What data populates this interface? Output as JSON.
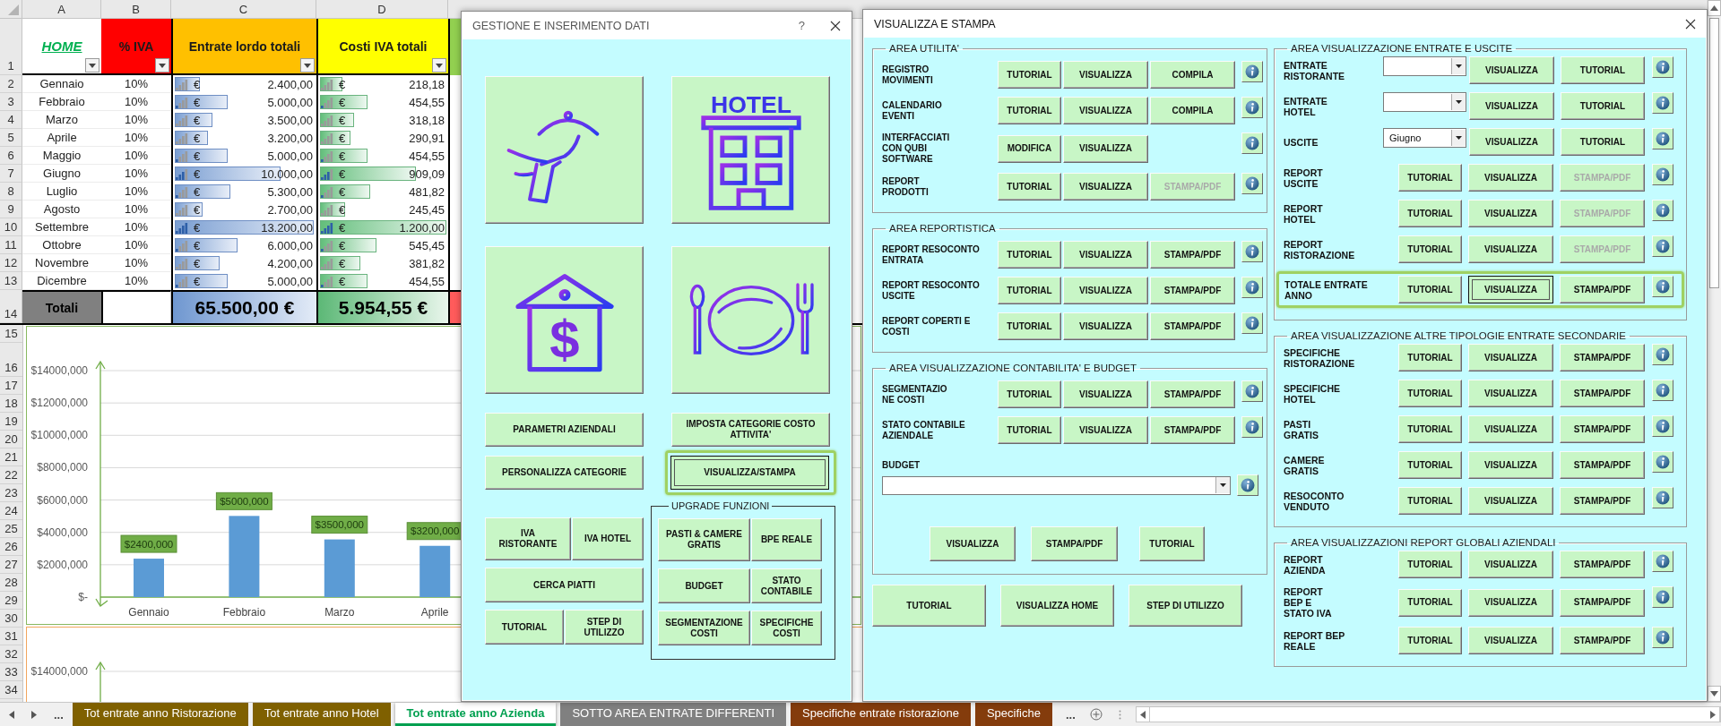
{
  "sheet": {
    "column_letters": [
      "A",
      "B",
      "C",
      "D"
    ],
    "columns": [
      {
        "label": "HOME",
        "kind": "link",
        "color": "#ffffff"
      },
      {
        "label": "% IVA",
        "kind": "text",
        "color": "#ff0000"
      },
      {
        "label": "Entrate lordo totali",
        "kind": "text",
        "color": "#ffc000"
      },
      {
        "label": "Costi IVA totali",
        "kind": "text",
        "color": "#ffff00"
      }
    ],
    "row_numbers": [
      "1",
      "2",
      "3",
      "4",
      "5",
      "6",
      "7",
      "8",
      "9",
      "10",
      "11",
      "12",
      "13",
      "14",
      "15",
      "16",
      "17",
      "18",
      "19",
      "20",
      "21",
      "22",
      "23",
      "24",
      "25",
      "26",
      "27",
      "28",
      "29",
      "30",
      "31",
      "32",
      "33",
      "34"
    ],
    "rows": [
      {
        "month": "Gennaio",
        "vat": "10%",
        "income": {
          "currency": "€",
          "value": "2.400,00",
          "level": 0.18
        },
        "vat_costs": {
          "currency": "€",
          "value": "218,18",
          "level": 0.18
        }
      },
      {
        "month": "Febbraio",
        "vat": "10%",
        "income": {
          "currency": "€",
          "value": "5.000,00",
          "level": 0.38
        },
        "vat_costs": {
          "currency": "€",
          "value": "454,55",
          "level": 0.38
        }
      },
      {
        "month": "Marzo",
        "vat": "10%",
        "income": {
          "currency": "€",
          "value": "3.500,00",
          "level": 0.27
        },
        "vat_costs": {
          "currency": "€",
          "value": "318,18",
          "level": 0.27
        }
      },
      {
        "month": "Aprile",
        "vat": "10%",
        "income": {
          "currency": "€",
          "value": "3.200,00",
          "level": 0.24
        },
        "vat_costs": {
          "currency": "€",
          "value": "290,91",
          "level": 0.24
        }
      },
      {
        "month": "Maggio",
        "vat": "10%",
        "income": {
          "currency": "€",
          "value": "5.000,00",
          "level": 0.38
        },
        "vat_costs": {
          "currency": "€",
          "value": "454,55",
          "level": 0.38
        }
      },
      {
        "month": "Giugno",
        "vat": "10%",
        "income": {
          "currency": "€",
          "value": "10.000,00",
          "level": 0.76
        },
        "vat_costs": {
          "currency": "€",
          "value": "909,09",
          "level": 0.76
        }
      },
      {
        "month": "Luglio",
        "vat": "10%",
        "income": {
          "currency": "€",
          "value": "5.300,00",
          "level": 0.4
        },
        "vat_costs": {
          "currency": "€",
          "value": "481,82",
          "level": 0.4
        }
      },
      {
        "month": "Agosto",
        "vat": "10%",
        "income": {
          "currency": "€",
          "value": "2.700,00",
          "level": 0.2
        },
        "vat_costs": {
          "currency": "€",
          "value": "245,45",
          "level": 0.2
        }
      },
      {
        "month": "Settembre",
        "vat": "10%",
        "income": {
          "currency": "€",
          "value": "13.200,00",
          "level": 1
        },
        "vat_costs": {
          "currency": "€",
          "value": "1.200,00",
          "level": 1
        }
      },
      {
        "month": "Ottobre",
        "vat": "10%",
        "income": {
          "currency": "€",
          "value": "6.000,00",
          "level": 0.45
        },
        "vat_costs": {
          "currency": "€",
          "value": "545,45",
          "level": 0.45
        }
      },
      {
        "month": "Novembre",
        "vat": "10%",
        "income": {
          "currency": "€",
          "value": "4.200,00",
          "level": 0.32
        },
        "vat_costs": {
          "currency": "€",
          "value": "381,82",
          "level": 0.32
        }
      },
      {
        "month": "Dicembre",
        "vat": "10%",
        "income": {
          "currency": "€",
          "value": "5.000,00",
          "level": 0.38
        },
        "vat_costs": {
          "currency": "€",
          "value": "454,55",
          "level": 0.38
        }
      }
    ],
    "totals": {
      "label": "Totali",
      "income": "65.500,00 €",
      "vat_costs": "5.954,55 €"
    },
    "chart": {
      "y_axis_labels": [
        "$14000,000",
        "$12000,000",
        "$10000,000",
        "$8000,000",
        "$6000,000",
        "$4000,000",
        "$2000,000",
        "$-"
      ],
      "value_labels": [
        "$2400,000",
        "$5000,000",
        "$3500,000",
        "$3200,000"
      ],
      "categories": [
        "Gennaio",
        "Febbraio",
        "Marzo",
        "Aprile"
      ]
    },
    "second_chart": {
      "ytick_label": "$14000,000"
    }
  },
  "sheet_tabs": {
    "more_left": "...",
    "tabs": [
      {
        "label": "Tot entrate anno Ristorazione",
        "color": "#7f6000",
        "selected": false
      },
      {
        "label": "Tot entrate anno Hotel",
        "color": "#7f6000",
        "selected": false
      },
      {
        "label": "Tot entrate anno Azienda",
        "color": "#00a050",
        "selected": true
      },
      {
        "label": "SOTTO AREA ENTRATE DIFFERENTI",
        "color": "#808080",
        "selected": false
      },
      {
        "label": "Specifiche entrate ristorazione",
        "color": "#843c0c",
        "selected": false
      },
      {
        "label": "Specifiche",
        "color": "#843c0c",
        "selected": false
      }
    ],
    "more_right": "..."
  },
  "management_dialog": {
    "title": "GESTIONE E INSERIMENTO DATI",
    "help": "?",
    "tiles": [
      {
        "kind": "waiter"
      },
      {
        "kind": "hotel",
        "sign": "HOTEL"
      },
      {
        "kind": "house-dollar",
        "sign": "$"
      },
      {
        "kind": "plate"
      }
    ],
    "buttons": [
      {
        "label": "PARAMETRI AZIENDALI",
        "focused": false,
        "highlighted": false
      },
      {
        "label": "IMPOSTA CATEGORIE COSTO\nATTIVITA'",
        "focused": false,
        "highlighted": false
      },
      {
        "label": "PERSONALIZZA CATEGORIE",
        "focused": false,
        "highlighted": false
      },
      {
        "label": "VISUALIZZA/STAMPA",
        "focused": true,
        "highlighted": true
      }
    ],
    "left_rows": [
      [
        {
          "label": "IVA\nRISTORANTE"
        },
        {
          "label": "IVA HOTEL"
        }
      ],
      [
        {
          "label": "CERCA PIATTI"
        }
      ],
      [
        {
          "label": "TUTORIAL"
        },
        {
          "label": "STEP DI\nUTILIZZO"
        }
      ]
    ],
    "upgrade": {
      "title": "UPGRADE FUNZIONI",
      "rows": [
        [
          {
            "label": "PASTI & CAMERE\nGRATIS"
          },
          {
            "label": "BPE REALE"
          }
        ],
        [
          {
            "label": "BUDGET"
          },
          {
            "label": "STATO\nCONTABILE"
          }
        ],
        [
          {
            "label": "SEGMENTAZIONE\nCOSTI"
          },
          {
            "label": "SPECIFICHE\nCOSTI"
          }
        ]
      ]
    }
  },
  "print_dialog": {
    "title": "VISUALIZZA E STAMPA",
    "columns": [
      {
        "groups": [
          {
            "title": "AREA UTILITA'",
            "rows": [
              {
                "kind": "row",
                "label": "REGISTRO\nMOVIMENTI",
                "highlighted": false,
                "info": true,
                "controls": [
                  {
                    "kind": "button",
                    "label": "TUTORIAL",
                    "disabled": false,
                    "focused": false
                  },
                  {
                    "kind": "button",
                    "label": "VISUALIZZA",
                    "disabled": false,
                    "focused": false
                  },
                  {
                    "kind": "button",
                    "label": "COMPILA",
                    "disabled": false,
                    "focused": false
                  }
                ]
              },
              {
                "kind": "row",
                "label": "CALENDARIO\nEVENTI",
                "highlighted": false,
                "info": true,
                "controls": [
                  {
                    "kind": "button",
                    "label": "TUTORIAL",
                    "disabled": false,
                    "focused": false
                  },
                  {
                    "kind": "button",
                    "label": "VISUALIZZA",
                    "disabled": false,
                    "focused": false
                  },
                  {
                    "kind": "button",
                    "label": "COMPILA",
                    "disabled": false,
                    "focused": false
                  }
                ]
              },
              {
                "kind": "row",
                "label": "INTERFACCIATI\nCON QUBI\nSOFTWARE",
                "highlighted": false,
                "info": true,
                "controls": [
                  {
                    "kind": "button",
                    "label": "MODIFICA",
                    "disabled": false,
                    "focused": false
                  },
                  {
                    "kind": "button",
                    "label": "VISUALIZZA",
                    "disabled": false,
                    "focused": false
                  }
                ]
              },
              {
                "kind": "row",
                "label": "REPORT\nPRODOTTI",
                "highlighted": false,
                "info": true,
                "controls": [
                  {
                    "kind": "button",
                    "label": "TUTORIAL",
                    "disabled": false,
                    "focused": false
                  },
                  {
                    "kind": "button",
                    "label": "VISUALIZZA",
                    "disabled": false,
                    "focused": false
                  },
                  {
                    "kind": "button",
                    "label": "STAMPA/PDF",
                    "disabled": true,
                    "focused": false
                  }
                ]
              }
            ]
          },
          {
            "title": "AREA REPORTISTICA",
            "rows": [
              {
                "kind": "row",
                "label": "REPORT RESOCONTO\nENTRATA",
                "highlighted": false,
                "info": true,
                "controls": [
                  {
                    "kind": "button",
                    "label": "TUTORIAL",
                    "disabled": false,
                    "focused": false
                  },
                  {
                    "kind": "button",
                    "label": "VISUALIZZA",
                    "disabled": false,
                    "focused": false
                  },
                  {
                    "kind": "button",
                    "label": "STAMPA/PDF",
                    "disabled": false,
                    "focused": false
                  }
                ]
              },
              {
                "kind": "row",
                "label": "REPORT RESOCONTO\nUSCITE",
                "highlighted": false,
                "info": true,
                "controls": [
                  {
                    "kind": "button",
                    "label": "TUTORIAL",
                    "disabled": false,
                    "focused": false
                  },
                  {
                    "kind": "button",
                    "label": "VISUALIZZA",
                    "disabled": false,
                    "focused": false
                  },
                  {
                    "kind": "button",
                    "label": "STAMPA/PDF",
                    "disabled": false,
                    "focused": false
                  }
                ]
              },
              {
                "kind": "row",
                "label": "REPORT COPERTI E\nCOSTI",
                "highlighted": false,
                "info": true,
                "controls": [
                  {
                    "kind": "button",
                    "label": "TUTORIAL",
                    "disabled": false,
                    "focused": false
                  },
                  {
                    "kind": "button",
                    "label": "VISUALIZZA",
                    "disabled": false,
                    "focused": false
                  },
                  {
                    "kind": "button",
                    "label": "STAMPA/PDF",
                    "disabled": false,
                    "focused": false
                  }
                ]
              }
            ]
          },
          {
            "title": "AREA VISUALIZZAZIONE CONTABILITA' E BUDGET",
            "rows": [
              {
                "kind": "row",
                "label": "SEGMENTAZIO\nNE COSTI",
                "highlighted": false,
                "info": true,
                "controls": [
                  {
                    "kind": "button",
                    "label": "TUTORIAL",
                    "disabled": false,
                    "focused": false
                  },
                  {
                    "kind": "button",
                    "label": "VISUALIZZA",
                    "disabled": false,
                    "focused": false
                  },
                  {
                    "kind": "button",
                    "label": "STAMPA/PDF",
                    "disabled": false,
                    "focused": false
                  }
                ]
              },
              {
                "kind": "row",
                "label": "STATO CONTABILE\nAZIENDALE",
                "highlighted": false,
                "info": true,
                "controls": [
                  {
                    "kind": "button",
                    "label": "TUTORIAL",
                    "disabled": false,
                    "focused": false
                  },
                  {
                    "kind": "button",
                    "label": "VISUALIZZA",
                    "disabled": false,
                    "focused": false
                  },
                  {
                    "kind": "button",
                    "label": "STAMPA/PDF",
                    "disabled": false,
                    "focused": false
                  }
                ]
              },
              {
                "kind": "caption",
                "label": "BUDGET"
              },
              {
                "kind": "wide-dropdown",
                "info": true
              },
              {
                "kind": "button-bar",
                "controls": [
                  {
                    "kind": "button",
                    "label": "VISUALIZZA",
                    "disabled": false,
                    "focused": false
                  },
                  {
                    "kind": "button",
                    "label": "STAMPA/PDF",
                    "disabled": false,
                    "focused": false
                  },
                  {
                    "kind": "button",
                    "label": "TUTORIAL",
                    "disabled": false,
                    "focused": false
                  }
                ]
              }
            ]
          }
        ],
        "footer": [
          {
            "label": "TUTORIAL"
          },
          {
            "label": "VISUALIZZA HOME"
          },
          {
            "label": "STEP DI UTILIZZO"
          }
        ]
      },
      {
        "groups": [
          {
            "title": "AREA VISUALIZZAZIONE ENTRATE E USCITE",
            "rows": [
              {
                "kind": "row",
                "label": "ENTRATE\nRISTORANTE",
                "highlighted": false,
                "info": true,
                "controls": [
                  {
                    "kind": "dropdown"
                  },
                  {
                    "kind": "button",
                    "label": "VISUALIZZA",
                    "disabled": false,
                    "focused": false
                  },
                  {
                    "kind": "button",
                    "label": "TUTORIAL",
                    "disabled": false,
                    "focused": false
                  }
                ]
              },
              {
                "kind": "row",
                "label": "ENTRATE\nHOTEL",
                "highlighted": false,
                "info": true,
                "controls": [
                  {
                    "kind": "dropdown"
                  },
                  {
                    "kind": "button",
                    "label": "VISUALIZZA",
                    "disabled": false,
                    "focused": false
                  },
                  {
                    "kind": "button",
                    "label": "TUTORIAL",
                    "disabled": false,
                    "focused": false
                  }
                ]
              },
              {
                "kind": "row",
                "label": "USCITE",
                "highlighted": false,
                "info": true,
                "controls": [
                  {
                    "kind": "dropdown",
                    "value": "Giugno"
                  },
                  {
                    "kind": "button",
                    "label": "VISUALIZZA",
                    "disabled": false,
                    "focused": false
                  },
                  {
                    "kind": "button",
                    "label": "TUTORIAL",
                    "disabled": false,
                    "focused": false
                  }
                ]
              },
              {
                "kind": "row",
                "label": "REPORT\nUSCITE",
                "highlighted": false,
                "info": true,
                "controls": [
                  {
                    "kind": "button",
                    "label": "TUTORIAL",
                    "disabled": false,
                    "focused": false
                  },
                  {
                    "kind": "button",
                    "label": "VISUALIZZA",
                    "disabled": false,
                    "focused": false
                  },
                  {
                    "kind": "button",
                    "label": "STAMPA/PDF",
                    "disabled": true,
                    "focused": false
                  }
                ]
              },
              {
                "kind": "row",
                "label": "REPORT\nHOTEL",
                "highlighted": false,
                "info": true,
                "controls": [
                  {
                    "kind": "button",
                    "label": "TUTORIAL",
                    "disabled": false,
                    "focused": false
                  },
                  {
                    "kind": "button",
                    "label": "VISUALIZZA",
                    "disabled": false,
                    "focused": false
                  },
                  {
                    "kind": "button",
                    "label": "STAMPA/PDF",
                    "disabled": true,
                    "focused": false
                  }
                ]
              },
              {
                "kind": "row",
                "label": "REPORT\nRISTORAZIONE",
                "highlighted": false,
                "info": true,
                "controls": [
                  {
                    "kind": "button",
                    "label": "TUTORIAL",
                    "disabled": false,
                    "focused": false
                  },
                  {
                    "kind": "button",
                    "label": "VISUALIZZA",
                    "disabled": false,
                    "focused": false
                  },
                  {
                    "kind": "button",
                    "label": "STAMPA/PDF",
                    "disabled": true,
                    "focused": false
                  }
                ]
              },
              {
                "kind": "row",
                "label": "TOTALE ENTRATE\nANNO",
                "highlighted": true,
                "info": true,
                "controls": [
                  {
                    "kind": "button",
                    "label": "TUTORIAL",
                    "disabled": false,
                    "focused": false
                  },
                  {
                    "kind": "button",
                    "label": "VISUALIZZA",
                    "disabled": false,
                    "focused": true
                  },
                  {
                    "kind": "button",
                    "label": "STAMPA/PDF",
                    "disabled": false,
                    "focused": false
                  }
                ]
              }
            ]
          },
          {
            "title": "AREA VISUALIZZAZIONE ALTRE TIPOLOGIE ENTRATE SECONDARIE",
            "rows": [
              {
                "kind": "row",
                "label": "SPECIFICHE\nRISTORAZIONE",
                "highlighted": false,
                "info": true,
                "controls": [
                  {
                    "kind": "button",
                    "label": "TUTORIAL",
                    "disabled": false,
                    "focused": false
                  },
                  {
                    "kind": "button",
                    "label": "VISUALIZZA",
                    "disabled": false,
                    "focused": false
                  },
                  {
                    "kind": "button",
                    "label": "STAMPA/PDF",
                    "disabled": false,
                    "focused": false
                  }
                ]
              },
              {
                "kind": "row",
                "label": "SPECIFICHE\nHOTEL",
                "highlighted": false,
                "info": true,
                "controls": [
                  {
                    "kind": "button",
                    "label": "TUTORIAL",
                    "disabled": false,
                    "focused": false
                  },
                  {
                    "kind": "button",
                    "label": "VISUALIZZA",
                    "disabled": false,
                    "focused": false
                  },
                  {
                    "kind": "button",
                    "label": "STAMPA/PDF",
                    "disabled": false,
                    "focused": false
                  }
                ]
              },
              {
                "kind": "row",
                "label": "PASTI\nGRATIS",
                "highlighted": false,
                "info": true,
                "controls": [
                  {
                    "kind": "button",
                    "label": "TUTORIAL",
                    "disabled": false,
                    "focused": false
                  },
                  {
                    "kind": "button",
                    "label": "VISUALIZZA",
                    "disabled": false,
                    "focused": false
                  },
                  {
                    "kind": "button",
                    "label": "STAMPA/PDF",
                    "disabled": false,
                    "focused": false
                  }
                ]
              },
              {
                "kind": "row",
                "label": "CAMERE\nGRATIS",
                "highlighted": false,
                "info": true,
                "controls": [
                  {
                    "kind": "button",
                    "label": "TUTORIAL",
                    "disabled": false,
                    "focused": false
                  },
                  {
                    "kind": "button",
                    "label": "VISUALIZZA",
                    "disabled": false,
                    "focused": false
                  },
                  {
                    "kind": "button",
                    "label": "STAMPA/PDF",
                    "disabled": false,
                    "focused": false
                  }
                ]
              },
              {
                "kind": "row",
                "label": "RESOCONTO\nVENDUTO",
                "highlighted": false,
                "info": true,
                "controls": [
                  {
                    "kind": "button",
                    "label": "TUTORIAL",
                    "disabled": false,
                    "focused": false
                  },
                  {
                    "kind": "button",
                    "label": "VISUALIZZA",
                    "disabled": false,
                    "focused": false
                  },
                  {
                    "kind": "button",
                    "label": "STAMPA/PDF",
                    "disabled": false,
                    "focused": false
                  }
                ]
              }
            ]
          },
          {
            "title": "AREA VISUALIZZAZIONI REPORT GLOBALI AZIENDALI",
            "rows": [
              {
                "kind": "row",
                "label": "REPORT\nAZIENDA",
                "highlighted": false,
                "info": true,
                "controls": [
                  {
                    "kind": "button",
                    "label": "TUTORIAL",
                    "disabled": false,
                    "focused": false
                  },
                  {
                    "kind": "button",
                    "label": "VISUALIZZA",
                    "disabled": false,
                    "focused": false
                  },
                  {
                    "kind": "button",
                    "label": "STAMPA/PDF",
                    "disabled": false,
                    "focused": false
                  }
                ]
              },
              {
                "kind": "row",
                "label": "REPORT\nBEP E\nSTATO IVA",
                "highlighted": false,
                "info": true,
                "controls": [
                  {
                    "kind": "button",
                    "label": "TUTORIAL",
                    "disabled": false,
                    "focused": false
                  },
                  {
                    "kind": "button",
                    "label": "VISUALIZZA",
                    "disabled": false,
                    "focused": false
                  },
                  {
                    "kind": "button",
                    "label": "STAMPA/PDF",
                    "disabled": false,
                    "focused": false
                  }
                ]
              },
              {
                "kind": "row",
                "label": "REPORT BEP\nREALE",
                "highlighted": false,
                "info": true,
                "controls": [
                  {
                    "kind": "button",
                    "label": "TUTORIAL",
                    "disabled": false,
                    "focused": false
                  },
                  {
                    "kind": "button",
                    "label": "VISUALIZZA",
                    "disabled": false,
                    "focused": false
                  },
                  {
                    "kind": "button",
                    "label": "STAMPA/PDF",
                    "disabled": false,
                    "focused": false
                  }
                ]
              }
            ]
          }
        ]
      }
    ]
  }
}
